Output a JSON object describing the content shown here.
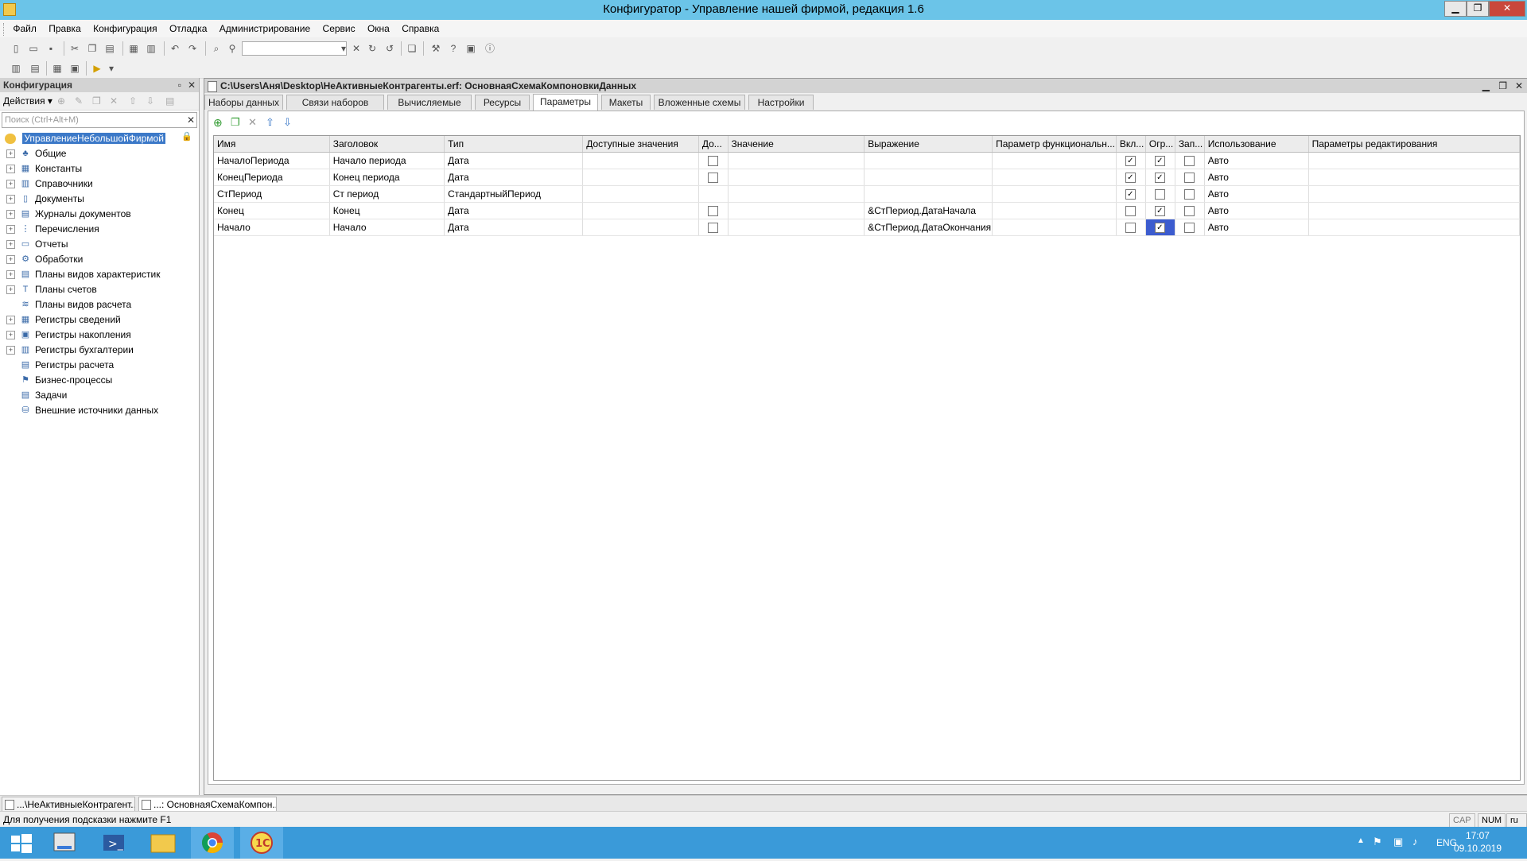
{
  "window": {
    "title": "Конфигуратор - Управление нашей фирмой, редакция 1.6"
  },
  "menu": [
    "Файл",
    "Правка",
    "Конфигурация",
    "Отладка",
    "Администрирование",
    "Сервис",
    "Окна",
    "Справка"
  ],
  "config_panel": {
    "title": "Конфигурация",
    "actions_label": "Действия",
    "search_placeholder": "Поиск (Ctrl+Alt+M)",
    "root": "УправлениеНебольшойФирмой",
    "items": [
      {
        "label": "Общие",
        "icon": "general-icon",
        "expandable": true
      },
      {
        "label": "Константы",
        "icon": "constants-icon",
        "expandable": true
      },
      {
        "label": "Справочники",
        "icon": "catalogs-icon",
        "expandable": true
      },
      {
        "label": "Документы",
        "icon": "documents-icon",
        "expandable": true
      },
      {
        "label": "Журналы документов",
        "icon": "journals-icon",
        "expandable": true
      },
      {
        "label": "Перечисления",
        "icon": "enums-icon",
        "expandable": true
      },
      {
        "label": "Отчеты",
        "icon": "reports-icon",
        "expandable": true
      },
      {
        "label": "Обработки",
        "icon": "dataprocessors-icon",
        "expandable": true
      },
      {
        "label": "Планы видов характеристик",
        "icon": "chart-of-characteristics-icon",
        "expandable": true
      },
      {
        "label": "Планы счетов",
        "icon": "chart-of-accounts-icon",
        "expandable": true
      },
      {
        "label": "Планы видов расчета",
        "icon": "calculation-types-icon",
        "expandable": false
      },
      {
        "label": "Регистры сведений",
        "icon": "info-registers-icon",
        "expandable": true
      },
      {
        "label": "Регистры накопления",
        "icon": "accumulation-registers-icon",
        "expandable": true
      },
      {
        "label": "Регистры бухгалтерии",
        "icon": "accounting-registers-icon",
        "expandable": true
      },
      {
        "label": "Регистры расчета",
        "icon": "calculation-registers-icon",
        "expandable": false
      },
      {
        "label": "Бизнес-процессы",
        "icon": "business-processes-icon",
        "expandable": false
      },
      {
        "label": "Задачи",
        "icon": "tasks-icon",
        "expandable": false
      },
      {
        "label": "Внешние источники данных",
        "icon": "external-sources-icon",
        "expandable": false
      }
    ]
  },
  "document": {
    "title": "C:\\Users\\Аня\\Desktop\\НеАктивныеКонтрагенты.erf: ОсновнаяСхемаКомпоновкиДанных",
    "tabs": [
      "Наборы данных",
      "Связи наборов данных",
      "Вычисляемые поля",
      "Ресурсы",
      "Параметры",
      "Макеты",
      "Вложенные схемы",
      "Настройки"
    ],
    "active_tab": "Параметры",
    "columns": [
      "Имя",
      "Заголовок",
      "Тип",
      "Доступные значения",
      "До...",
      "Значение",
      "Выражение",
      "Параметр функциональн...",
      "Вкл...",
      "Огр...",
      "Зап...",
      "Использование",
      "Параметры редактирования"
    ],
    "rows": [
      {
        "name": "НачалоПериода",
        "caption": "Начало периода",
        "type": "Дата",
        "available": "",
        "list": false,
        "value": "",
        "expression": "",
        "fo_param": "",
        "include": true,
        "restrict": true,
        "fill": false,
        "usage": "Авто",
        "edit": ""
      },
      {
        "name": "КонецПериода",
        "caption": "Конец периода",
        "type": "Дата",
        "available": "",
        "list": false,
        "value": "",
        "expression": "",
        "fo_param": "",
        "include": true,
        "restrict": true,
        "fill": false,
        "usage": "Авто",
        "edit": ""
      },
      {
        "name": "СтПериод",
        "caption": "Ст период",
        "type": "СтандартныйПериод",
        "available": "",
        "list": null,
        "value": "",
        "expression": "",
        "fo_param": "",
        "include": true,
        "restrict": false,
        "fill": false,
        "usage": "Авто",
        "edit": ""
      },
      {
        "name": "Конец",
        "caption": "Конец",
        "type": "Дата",
        "available": "",
        "list": false,
        "value": "",
        "expression": "&СтПериод.ДатаНачала",
        "fo_param": "",
        "include": false,
        "restrict": true,
        "fill": false,
        "usage": "Авто",
        "edit": ""
      },
      {
        "name": "Начало",
        "caption": "Начало",
        "type": "Дата",
        "available": "",
        "list": false,
        "value": "",
        "expression": "&СтПериод.ДатаОкончания",
        "fo_param": "",
        "include": false,
        "restrict": true,
        "fill": false,
        "usage": "Авто",
        "edit": ""
      }
    ]
  },
  "window_tabs": [
    "...\\НеАктивныеКонтрагент...",
    "...: ОсновнаяСхемаКомпон..."
  ],
  "status": {
    "hint": "Для получения подсказки нажмите F1",
    "cap": "CAP",
    "num": "NUM",
    "lang": "ru"
  },
  "taskbar": {
    "lang": "ENG",
    "time": "17:07",
    "date": "09.10.2019"
  },
  "colors": {
    "titlebar": "#6bc4e8",
    "selection": "#3c79c8",
    "taskbar": "#3a9ad9"
  }
}
